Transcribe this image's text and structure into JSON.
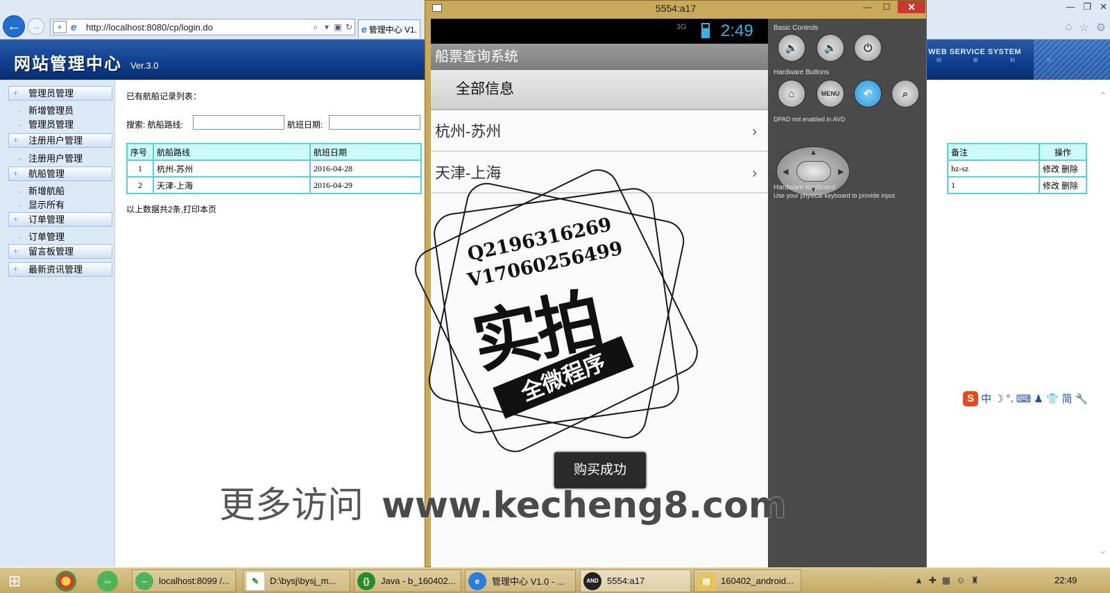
{
  "browser": {
    "url": "http://localhost:8080/cp/login.do",
    "tab_title": "管理中心 V1.",
    "back_icon": "back-arrow-icon",
    "forward_icon": "forward-arrow-icon"
  },
  "cms": {
    "title": "网站管理中心",
    "version": "Ver.3.0",
    "service_label": "WEB SERVICE SYSTEM",
    "service_sub": "网 新 科 技",
    "sidebar": [
      {
        "label": "管理员管理",
        "items": [
          "新增管理员",
          "管理员管理"
        ]
      },
      {
        "label": "注册用户管理",
        "items": [
          "注册用户管理"
        ]
      },
      {
        "label": "航船管理",
        "items": [
          "新增航船",
          "显示所有"
        ]
      },
      {
        "label": "订单管理",
        "items": [
          "订单管理"
        ]
      },
      {
        "label": "留言板管理",
        "items": []
      },
      {
        "label": "最新资讯管理",
        "items": []
      }
    ],
    "list_title": "已有航船记录列表：",
    "search_label": "搜索:  航船路线:",
    "date_label": "航班日期:",
    "table": {
      "headers": [
        "序号",
        "航船路线",
        "航班日期"
      ],
      "rows": [
        [
          "1",
          "杭州-苏州",
          "2016-04-28"
        ],
        [
          "2",
          "天津-上海",
          "2016-04-29"
        ]
      ],
      "right_headers": [
        "备注",
        "操作"
      ],
      "right_rows": [
        {
          "note": "hz-sz",
          "edit": "修改",
          "delete": "删除"
        },
        {
          "note": "1",
          "edit": "修改",
          "delete": "删除"
        }
      ]
    },
    "footer": "以上数据共2条,打印本页"
  },
  "emulator": {
    "window_title": "5554:a17",
    "status": {
      "network": "3G",
      "time": "2:49"
    },
    "app_title": "船票查询系统",
    "tab_label": "全部信息",
    "routes": [
      "杭州-苏州",
      "天津-上海"
    ],
    "toast": "购买成功",
    "panel": {
      "basic_controls": "Basic Controls",
      "hardware_buttons": "Hardware Buttons",
      "menu_label": "MENU",
      "dpad_note": "DPAD not enabled in AVD",
      "keyboard_title": "Hardware Keyboard",
      "keyboard_note": "Use your physical keyboard to provide input"
    }
  },
  "watermark": {
    "qq": "Q2196316269",
    "wechat": "V17060256499",
    "big": "实拍",
    "banner": "全微程序",
    "bottom_cn": "更多访问",
    "bottom_url": "www.kecheng8.com"
  },
  "ime": {
    "items": [
      "中",
      "简"
    ]
  },
  "taskbar": {
    "items": [
      "localhost:8099 /...",
      "D:\\bysj\\bysj_m...",
      "Java - b_160402...",
      "管理中心 V1.0 - ...",
      "5554:a17",
      "160402_android..."
    ],
    "clock": "22:49",
    "and_badge": "AND"
  }
}
